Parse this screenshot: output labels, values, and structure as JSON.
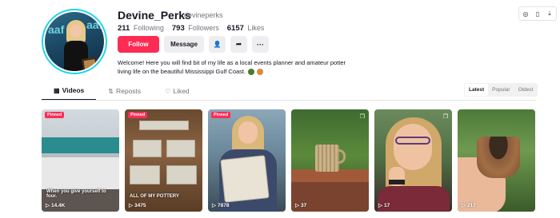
{
  "top_bar": {
    "icons": [
      "compass-icon",
      "phone-icon",
      "download-icon"
    ],
    "glyphs": [
      "◎",
      "▯",
      "⤓"
    ]
  },
  "profile": {
    "username": "Devine_Perks",
    "handle": "devineperks",
    "avatar_logo_text": "aaf",
    "stats": {
      "following_count": "211",
      "following_label": "Following",
      "followers_count": "793",
      "followers_label": "Followers",
      "likes_count": "6157",
      "likes_label": "Likes"
    },
    "actions": {
      "follow_label": "Follow",
      "message_label": "Message",
      "add_friend_glyph": "👤",
      "share_glyph": "➦",
      "more_glyph": "···"
    },
    "bio": "Welcome! Here you will find bit of my life as a local events planner and amateur potter living life on the beautiful Mississippi Gulf Coast.",
    "bio_emojis": [
      "leaf-emoji",
      "oyster-emoji"
    ]
  },
  "tabs": [
    {
      "label": "Videos",
      "icon": "grid-icon",
      "glyph": "▦",
      "active": true
    },
    {
      "label": "Reposts",
      "icon": "repost-icon",
      "glyph": "⇅",
      "active": false
    },
    {
      "label": "Liked",
      "icon": "liked-icon",
      "glyph": "♡",
      "active": false
    }
  ],
  "sort": {
    "options": [
      "Latest",
      "Popular",
      "Oldest"
    ],
    "selected": "Latest"
  },
  "videos": [
    {
      "pinned": true,
      "pinned_label": "Pinned",
      "views": "14.4K",
      "caption": "When you give yourself to four.",
      "multi": false
    },
    {
      "pinned": true,
      "pinned_label": "Pinned",
      "views": "3475",
      "caption": "ALL OF MY POTTERY",
      "multi": false
    },
    {
      "pinned": true,
      "pinned_label": "Pinned",
      "views": "7878",
      "caption": "",
      "multi": false
    },
    {
      "pinned": false,
      "pinned_label": "",
      "views": "37",
      "caption": "",
      "multi": true
    },
    {
      "pinned": false,
      "pinned_label": "",
      "views": "17",
      "caption": "",
      "multi": true
    },
    {
      "pinned": false,
      "pinned_label": "",
      "views": "217",
      "caption": "",
      "multi": false
    }
  ],
  "colors": {
    "accent": "#fe2c55",
    "avatar_ring": "#20d5ec",
    "text_primary": "#161823",
    "text_secondary": "#73757c"
  }
}
